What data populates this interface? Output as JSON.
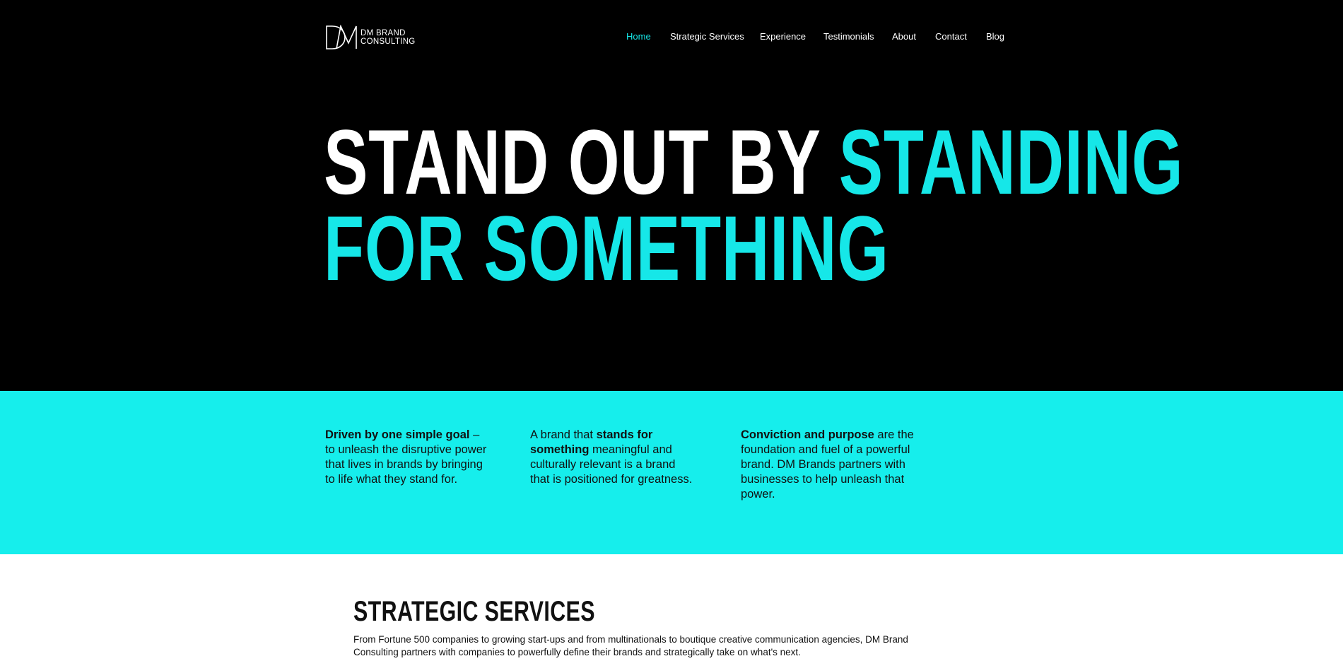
{
  "brand": {
    "line1": "DM BRAND",
    "line2": "CONSULTING",
    "accent": "#16e7e8"
  },
  "nav": {
    "items": [
      {
        "label": "Home",
        "active": true
      },
      {
        "label": "Strategic Services",
        "active": false
      },
      {
        "label": "Experience",
        "active": false
      },
      {
        "label": "Testimonials",
        "active": false
      },
      {
        "label": "About",
        "active": false
      },
      {
        "label": "Contact",
        "active": false
      },
      {
        "label": "Blog",
        "active": false
      }
    ]
  },
  "hero": {
    "headline_white": "STAND OUT BY",
    "headline_cyan_1": "STANDING",
    "headline_cyan_2": "FOR SOMETHING"
  },
  "pillars": [
    {
      "bold": "Driven by one simple goal",
      "text": " – to unleash the disruptive power that lives in brands by bringing to life what they stand for."
    },
    {
      "pre": "A brand that ",
      "bold": "stands for something",
      "text": " meaningful and culturally relevant is a brand that is positioned for greatness."
    },
    {
      "bold": "Conviction and purpose",
      "text": " are the foundation and fuel of a powerful brand. DM Brands partners with businesses to help unleash that power."
    }
  ],
  "services": {
    "title": "STRATEGIC SERVICES",
    "intro": "From Fortune 500 companies to growing start-ups and from multinationals to boutique creative communication agencies, DM Brand Consulting partners with companies to powerfully define their brands and strategically take on what's next."
  }
}
